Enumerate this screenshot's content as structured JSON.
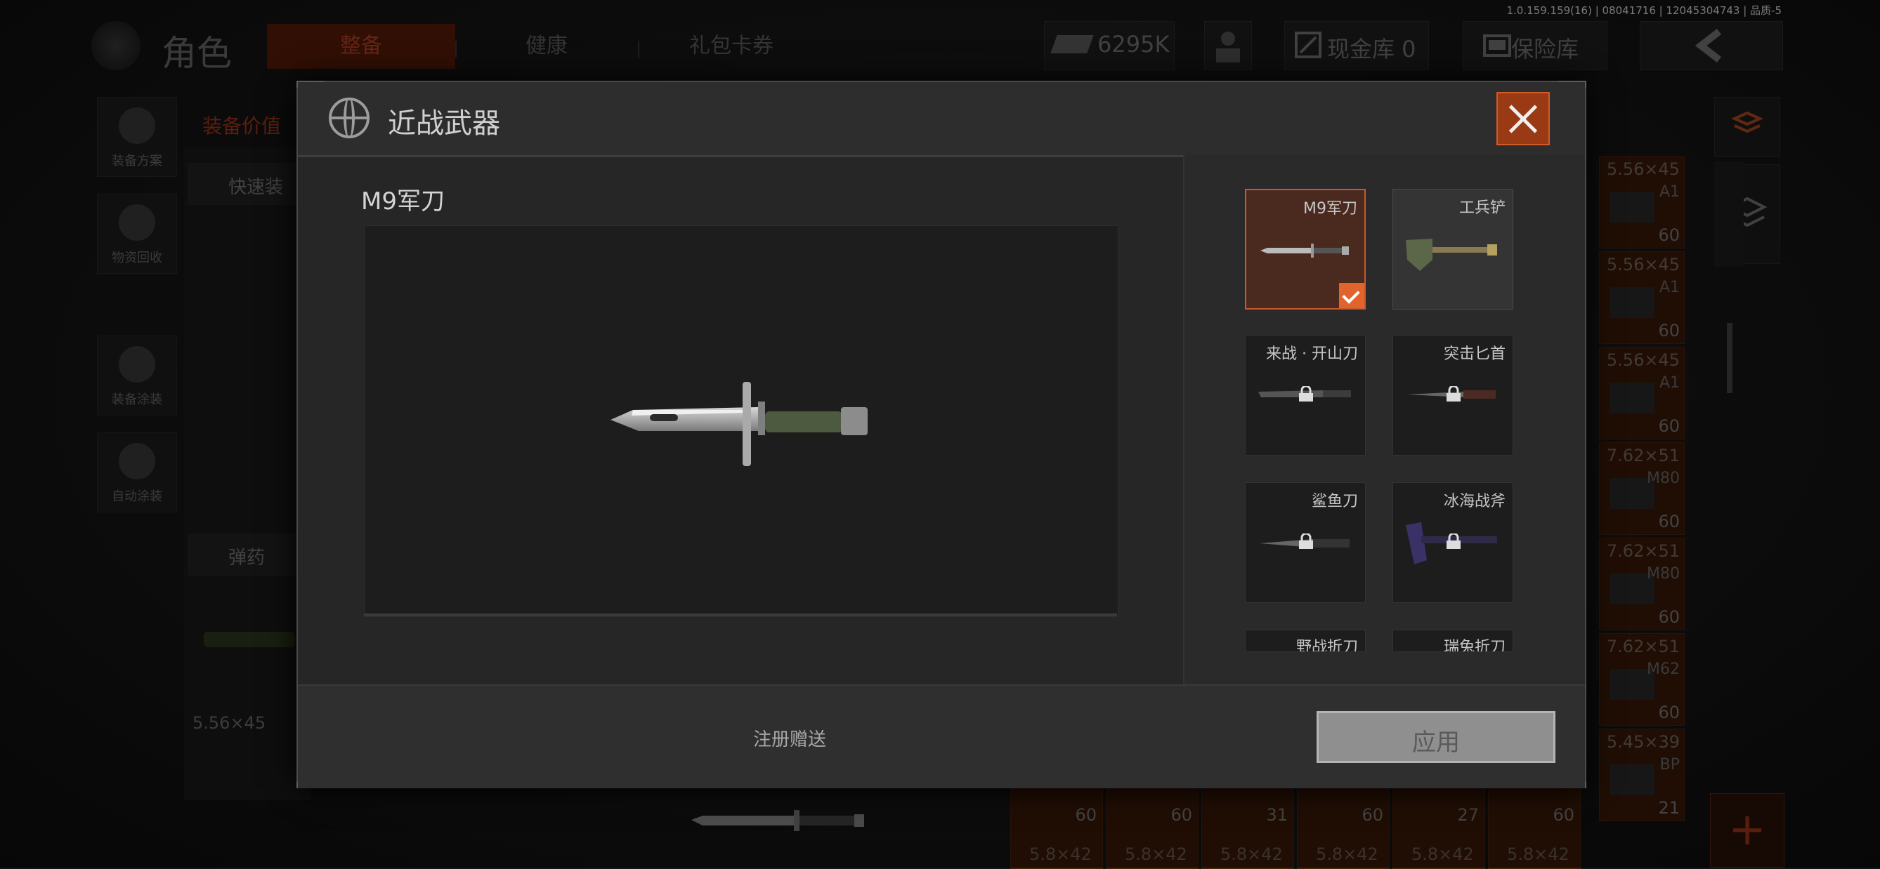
{
  "version": "1.0.159.159(16) | 08041716 | 12045304743 | 品质-5",
  "header": {
    "title": "角色",
    "tabs": [
      {
        "label": "整备",
        "active": true
      },
      {
        "label": "健康",
        "active": false
      },
      {
        "label": "礼包卡券",
        "active": false
      }
    ],
    "currency": "6295K",
    "cash_vault": "现金库 0",
    "safe_box": "保险库"
  },
  "sidebar": {
    "items": [
      {
        "label": "装备方案",
        "icon": "gear-plan-icon"
      },
      {
        "label": "物资回收",
        "icon": "recycle-icon"
      },
      {
        "label": "装备涂装",
        "icon": "helmet-paint-icon"
      },
      {
        "label": "自动涂装",
        "icon": "auto-paint-icon"
      }
    ]
  },
  "left_panel": {
    "header": "装备价值",
    "quick_label": "快速装",
    "ammo_label": "弹药",
    "caliber": "5.56×45"
  },
  "ammo_grid": [
    {
      "caliber": "5.56×45",
      "code": "A1",
      "count": "60"
    },
    {
      "caliber": "5.56×45",
      "code": "A1",
      "count": "60"
    },
    {
      "caliber": "5.56×45",
      "code": "A1",
      "count": "60"
    },
    {
      "caliber": "7.62×51",
      "code": "M80",
      "count": "60"
    },
    {
      "caliber": "7.62×51",
      "code": "M80",
      "count": "60"
    },
    {
      "caliber": "7.62×51",
      "code": "M62",
      "count": "60"
    },
    {
      "caliber": "5.45×39",
      "code": "BP",
      "count": "21"
    }
  ],
  "bottom_row": [
    {
      "count": "60",
      "caliber": "5.8×42"
    },
    {
      "count": "60",
      "caliber": "5.8×42"
    },
    {
      "count": "31",
      "caliber": "5.8×42"
    },
    {
      "count": "60",
      "caliber": "5.8×42"
    },
    {
      "count": "27",
      "caliber": "5.8×42"
    },
    {
      "count": "60",
      "caliber": "5.8×42"
    }
  ],
  "modal": {
    "title": "近战武器",
    "selected_name": "M9军刀",
    "items": [
      {
        "name": "M9军刀",
        "state": "selected"
      },
      {
        "name": "工兵铲",
        "state": "unlocked"
      },
      {
        "name": "来战 · 开山刀",
        "state": "locked"
      },
      {
        "name": "突击匕首",
        "state": "locked"
      },
      {
        "name": "鲨鱼刀",
        "state": "locked"
      },
      {
        "name": "冰海战斧",
        "state": "locked"
      },
      {
        "name": "野战折刀",
        "state": "locked"
      },
      {
        "name": "瑞兔折刀",
        "state": "locked"
      }
    ],
    "source_text": "注册赠送",
    "apply_label": "应用"
  },
  "colors": {
    "accent": "#e0642c",
    "selected_bg": "#4a2a1e",
    "tab_active": "#5a1c08"
  }
}
